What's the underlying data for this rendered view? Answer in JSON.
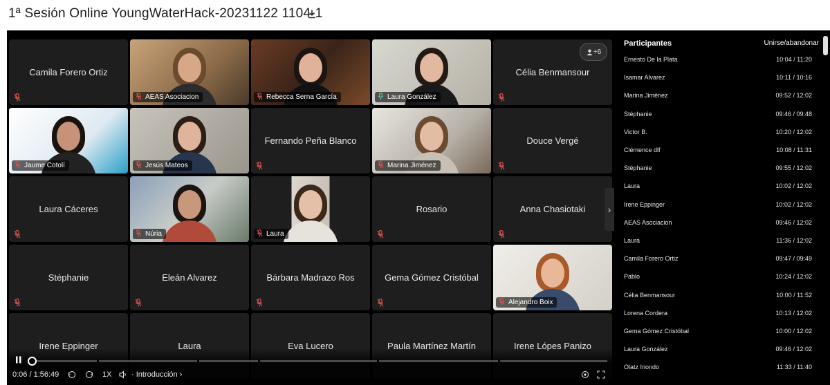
{
  "title": "1ª Sesión Online YoungWaterHack-20231122 1104-1",
  "more_participants": "+6",
  "tiles": [
    {
      "name": "Camila Forero Ortiz",
      "video": false
    },
    {
      "name": "AEAS Asociacion",
      "video": true
    },
    {
      "name": "Rebecca Serna García",
      "video": true
    },
    {
      "name": "Laura González",
      "video": true
    },
    {
      "name": "Célia Benmansour",
      "video": false
    },
    {
      "name": "Jaume Cotolí",
      "video": true
    },
    {
      "name": "Jesús Mateos",
      "video": true
    },
    {
      "name": "Fernando Peña Blanco",
      "video": false
    },
    {
      "name": "Marina Jiménez",
      "video": true
    },
    {
      "name": "Douce Vergé",
      "video": false
    },
    {
      "name": "Laura Cáceres",
      "video": false
    },
    {
      "name": "Núria",
      "video": true
    },
    {
      "name": "Laura",
      "video": true
    },
    {
      "name": "Rosario",
      "video": false
    },
    {
      "name": "Anna Chasiotaki",
      "video": false
    },
    {
      "name": "Stéphanie",
      "video": false
    },
    {
      "name": "Eleán Alvarez",
      "video": false
    },
    {
      "name": "Bárbara Madrazo Ros",
      "video": false
    },
    {
      "name": "Gema Gómez Cristóbal",
      "video": false
    },
    {
      "name": "Alejandro Boix",
      "video": true
    },
    {
      "name": "Irene Eppinger",
      "video": false
    },
    {
      "name": "Laura",
      "video": false
    },
    {
      "name": "Eva Lucero",
      "video": false
    },
    {
      "name": "Paula Martínez Martín",
      "video": false
    },
    {
      "name": "Irene Lópes Panizo",
      "video": false
    }
  ],
  "controls": {
    "time": "0:06 / 1:56:49",
    "speed": "1X",
    "chapter": "Introducción"
  },
  "sidebar": {
    "header": "Participantes",
    "header_right": "Unirse/abandonar",
    "participants": [
      {
        "name": "Ernesto De la Plata",
        "time": "10:04 / 11:20"
      },
      {
        "name": "Isamar Alvarez",
        "time": "10:11 / 10:16"
      },
      {
        "name": "Marina Jiménez",
        "time": "09:52 / 12:02"
      },
      {
        "name": "Stéphanie",
        "time": "09:46 / 09:48"
      },
      {
        "name": "Victor B.",
        "time": "10:20 / 12:02"
      },
      {
        "name": "Clémence dlf",
        "time": "10:08 / 11:31"
      },
      {
        "name": "Stéphanie",
        "time": "09:55 / 12:02"
      },
      {
        "name": "Laura",
        "time": "10:02 / 12:02"
      },
      {
        "name": "Irene Eppinger",
        "time": "10:02 / 12:02"
      },
      {
        "name": "AEAS Asociacion",
        "time": "09:46 / 12:02"
      },
      {
        "name": "Laura",
        "time": "11:36 / 12:02"
      },
      {
        "name": "Camila Forero Ortiz",
        "time": "09:47 / 09:49"
      },
      {
        "name": "Pablo",
        "time": "10:24 / 12:02"
      },
      {
        "name": "Célia Benmansour",
        "time": "10:00 / 11:52"
      },
      {
        "name": "Lorena Cordera",
        "time": "10:13 / 12:02"
      },
      {
        "name": "Gema Gómez Cristóbal",
        "time": "10:00 / 12:02"
      },
      {
        "name": "Laura González",
        "time": "09:46 / 12:02"
      },
      {
        "name": "Olatz Iriondo",
        "time": "11:33 / 11:40"
      }
    ]
  },
  "colors": {
    "active_speaker": "#5fd1b4",
    "muted": "#d9534f",
    "tile_bg": "#1e1e1e"
  }
}
